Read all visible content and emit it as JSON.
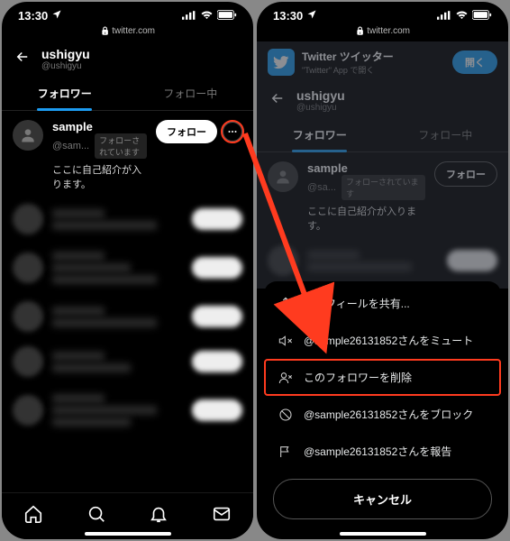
{
  "status": {
    "time": "13:30",
    "signal_icon": "signal",
    "wifi_icon": "wifi",
    "battery_icon": "battery"
  },
  "url": "twitter.com",
  "left": {
    "header": {
      "title": "ushigyu",
      "subtitle": "@ushigyu"
    },
    "tabs": {
      "followers": "フォロワー",
      "following": "フォロー中",
      "active": 0
    },
    "user": {
      "name": "sample",
      "handle": "@sam...",
      "badge": "フォローされています",
      "follow_label": "フォロー",
      "bio": "ここに自己紹介が入ります。"
    }
  },
  "right": {
    "banner": {
      "title": "Twitter ツイッター",
      "subtitle": "\"Twitter\" App で開く",
      "open_label": "開く"
    },
    "header": {
      "title": "ushigyu",
      "subtitle": "@ushigyu"
    },
    "tabs": {
      "followers": "フォロワー",
      "following": "フォロー中",
      "active": 0
    },
    "user": {
      "name": "sample",
      "handle": "@sa...",
      "badge": "フォローされています",
      "follow_label": "フォロー",
      "bio": "ここに自己紹介が入ります。"
    },
    "sheet": {
      "share": "プロフィールを共有...",
      "mute": "@sample26131852さんをミュート",
      "remove": "このフォロワーを削除",
      "block": "@sample26131852さんをブロック",
      "report": "@sample26131852さんを報告",
      "cancel": "キャンセル"
    }
  }
}
